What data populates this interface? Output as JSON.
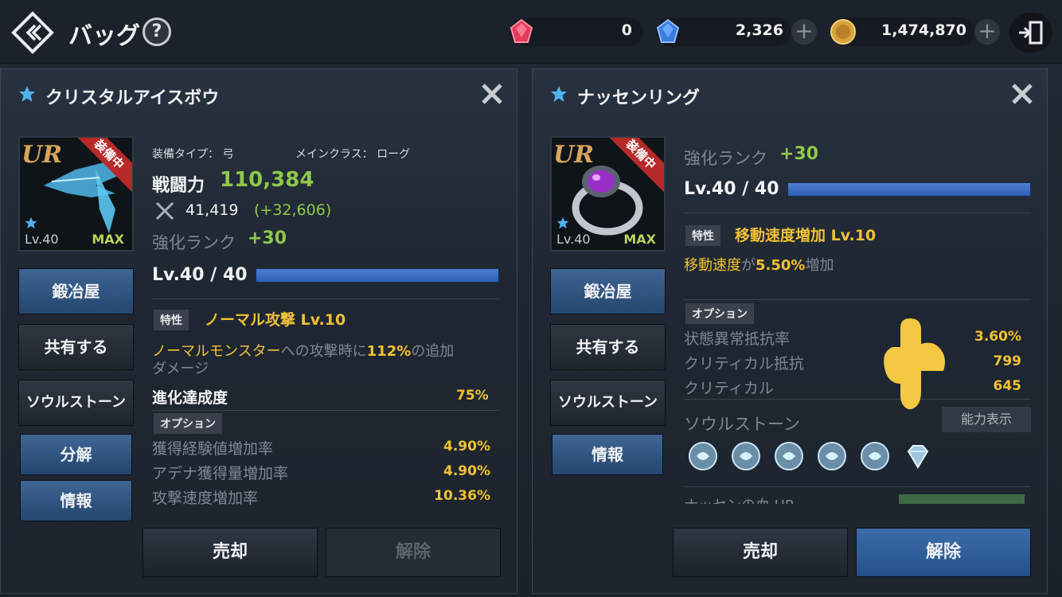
{
  "header": {
    "title": "バッグ",
    "currencies": [
      {
        "name": "red-gem",
        "value": "0",
        "color": "#e23b5b"
      },
      {
        "name": "blue-gem",
        "value": "2,326",
        "color": "#3a7be0"
      },
      {
        "name": "gold-coin",
        "value": "1,474,870",
        "color": "#d6a23a"
      }
    ]
  },
  "left": {
    "title": "クリスタルアイスボウ",
    "thumb": {
      "rarity": "UR",
      "level": "Lv.40",
      "max": "MAX",
      "equipped": "装備中"
    },
    "equip_type": "装備タイプ： 弓",
    "main_class": "メインクラス： ローグ",
    "power_label": "戦闘力",
    "power_value": "110,384",
    "attack_value": "41,419",
    "attack_bonus": "(+32,606)",
    "rank_label": "強化ランク",
    "rank_value": "+30",
    "level_text": "Lv.40 / 40",
    "level_fill": 1.0,
    "trait_badge": "特性",
    "trait_name": "ノーマル攻撃 Lv.10",
    "trait_desc_hl": "ノーマルモンスター",
    "trait_desc_mid": "への攻撃時に",
    "trait_desc_pct": "112%",
    "trait_desc_end": "の追加",
    "trait_desc_line2": "ダメージ",
    "evo_label": "進化達成度",
    "evo_value": "75%",
    "option_badge": "オプション",
    "options": [
      {
        "label": "獲得経験値増加率",
        "value": "4.90%"
      },
      {
        "label": "アデナ獲得量増加率",
        "value": "4.90%"
      },
      {
        "label": "攻撃速度増加率",
        "value": "10.36%"
      }
    ],
    "buttons": {
      "smith": "鍛冶屋",
      "share": "共有する",
      "soulstone": "ソウルストーン",
      "disassemble": "分解",
      "info": "情報",
      "sell": "売却",
      "release": "解除"
    }
  },
  "right": {
    "title": "ナッセンリング",
    "thumb": {
      "rarity": "UR",
      "level": "Lv.40",
      "max": "MAX",
      "equipped": "装備中"
    },
    "rank_label": "強化ランク",
    "rank_value": "+30",
    "level_text": "Lv.40 / 40",
    "level_fill": 1.0,
    "trait_badge": "特性",
    "trait_name": "移動速度増加 Lv.10",
    "trait_desc_hl": "移動速度",
    "trait_desc_mid": "が",
    "trait_desc_pct": "5.50%",
    "trait_desc_end": "増加",
    "option_badge": "オプション",
    "options": [
      {
        "label": "状態異常抵抗率",
        "value": "3.60%"
      },
      {
        "label": "クリティカル抵抗",
        "value": "799"
      },
      {
        "label": "クリティカル",
        "value": "645"
      }
    ],
    "soulstone_label": "ソウルストーン",
    "ability_btn": "能力表示",
    "set_label": "ナッセンの血 UR",
    "buttons": {
      "smith": "鍛冶屋",
      "share": "共有する",
      "soulstone": "ソウルストーン",
      "info": "情報",
      "sell": "売却",
      "release": "解除"
    }
  }
}
